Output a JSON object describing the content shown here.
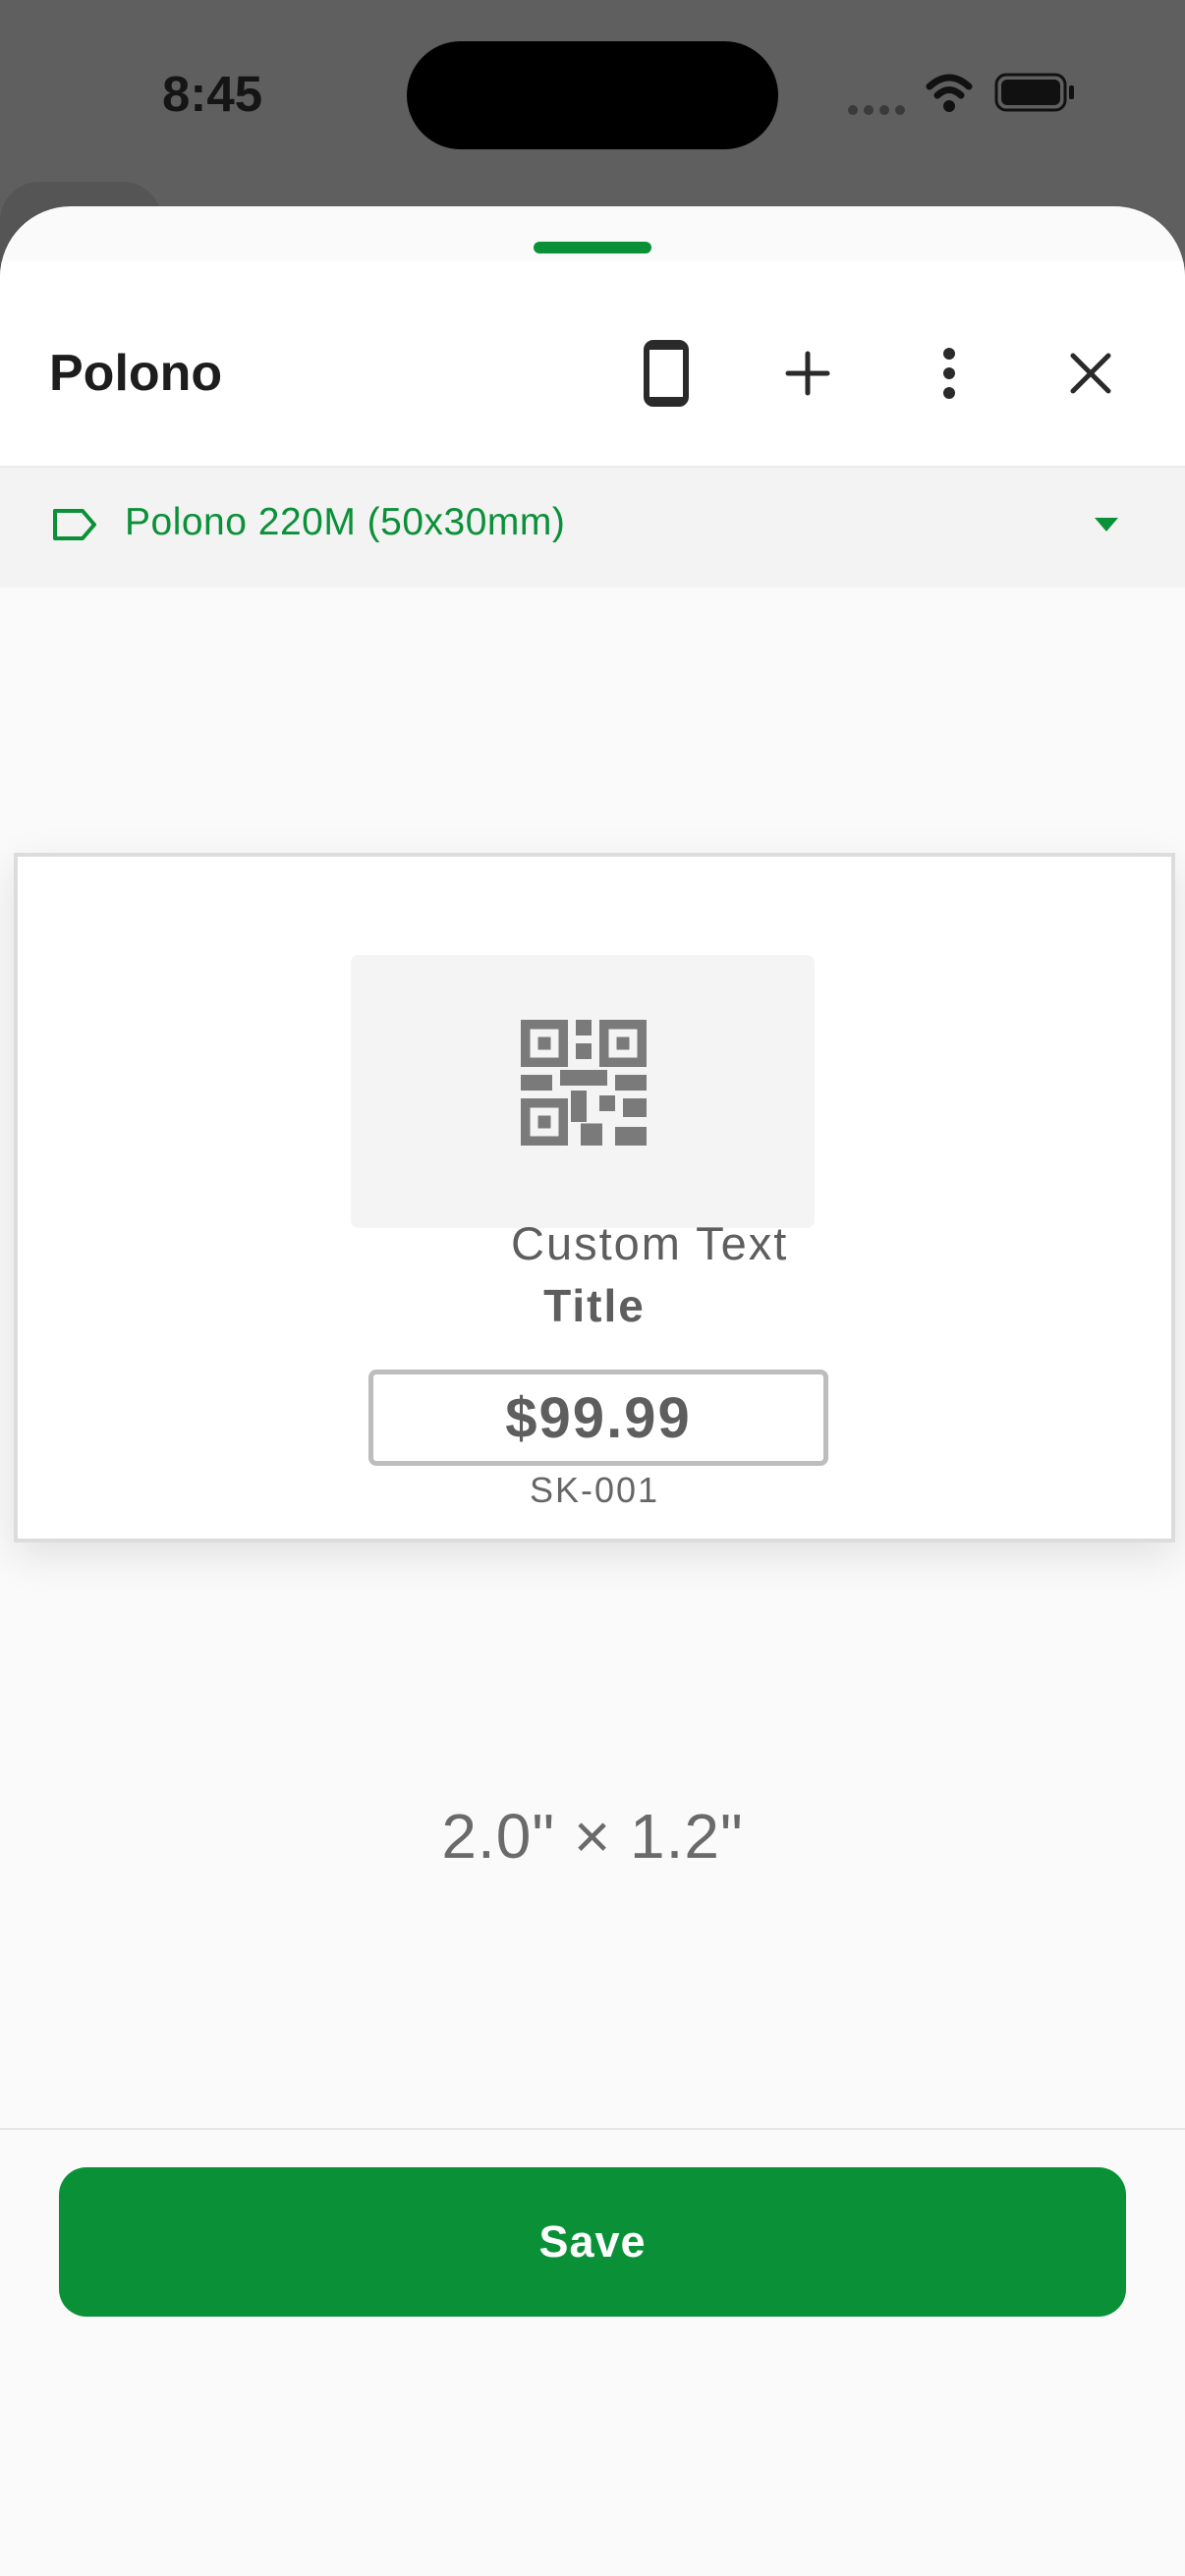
{
  "status_bar": {
    "time": "8:45"
  },
  "sheet": {
    "title": "Polono",
    "header_icons": [
      "phone-icon",
      "plus-icon",
      "more-vertical-icon",
      "close-icon"
    ]
  },
  "size_selector": {
    "label": "Polono 220M (50x30mm)",
    "icon": "tag-icon"
  },
  "label_preview": {
    "custom_text": "Custom Text",
    "title": "Title",
    "price": "$99.99",
    "sku": "SK-001"
  },
  "dimensions": "2.0\" × 1.2\"",
  "actions": {
    "save_label": "Save"
  },
  "colors": {
    "accent": "#0a9138",
    "overlay": "#5f5f5f",
    "sheet_bg": "#fafafa"
  }
}
